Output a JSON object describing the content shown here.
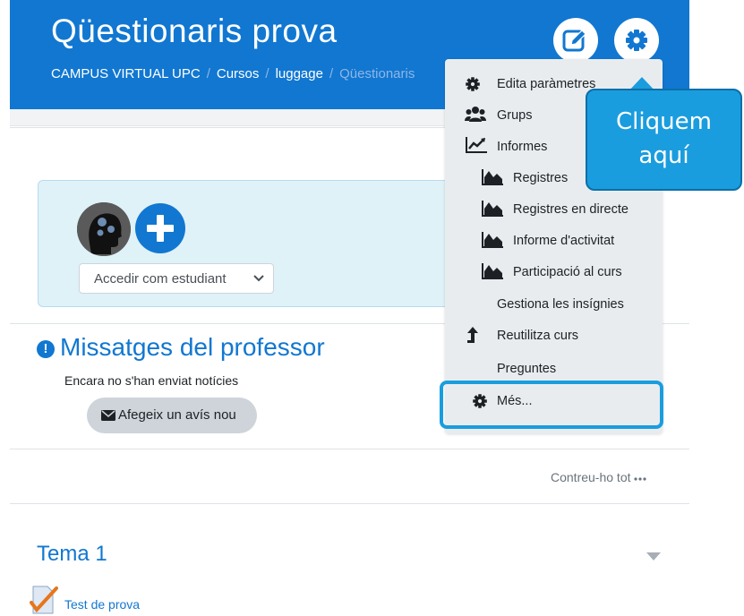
{
  "header": {
    "title": "Qüestionaris prova",
    "breadcrumb": [
      "CAMPUS VIRTUAL UPC",
      "Cursos",
      "luggage",
      "Qüestionaris"
    ],
    "edit_icon": "edit-pencil-icon",
    "settings_icon": "gear-icon"
  },
  "student": {
    "select_value": "Accedir com estudiant",
    "avatar_icon": "brain-gears-icon",
    "add_icon": "plus-icon"
  },
  "news": {
    "title": "Missatges del professor",
    "empty_text": "Encara no s'han enviat notícies",
    "add_label": "Afegeix un avís nou"
  },
  "collapse_label": "Contreu-ho tot",
  "section": {
    "title": "Tema 1",
    "items": [
      {
        "label": "Test de prova",
        "icon": "quiz-checkmark-icon"
      }
    ]
  },
  "menu": {
    "items": [
      {
        "label": "Edita paràmetres",
        "icon": "gear-icon"
      },
      {
        "label": "Grups",
        "icon": "users-icon"
      },
      {
        "label": "Informes",
        "icon": "line-chart-icon"
      },
      {
        "label": "Registres",
        "icon": "area-chart-icon"
      },
      {
        "label": "Registres en directe",
        "icon": "area-chart-icon"
      },
      {
        "label": "Informe d'activitat",
        "icon": "area-chart-icon"
      },
      {
        "label": "Participació al curs",
        "icon": "area-chart-icon"
      },
      {
        "label": "Gestiona les insígnies",
        "icon": ""
      },
      {
        "label": "Reutilitza curs",
        "icon": "level-up-icon"
      },
      {
        "label": "Preguntes",
        "icon": ""
      },
      {
        "label": "Més...",
        "icon": "gear-icon"
      }
    ]
  },
  "callout": {
    "line1": "Cliquem",
    "line2": "aquí"
  },
  "colors": {
    "brand": "#1177d1",
    "menu_bg": "#e9ecef",
    "callout": "#1a9dde",
    "student_box": "#def2f8"
  }
}
